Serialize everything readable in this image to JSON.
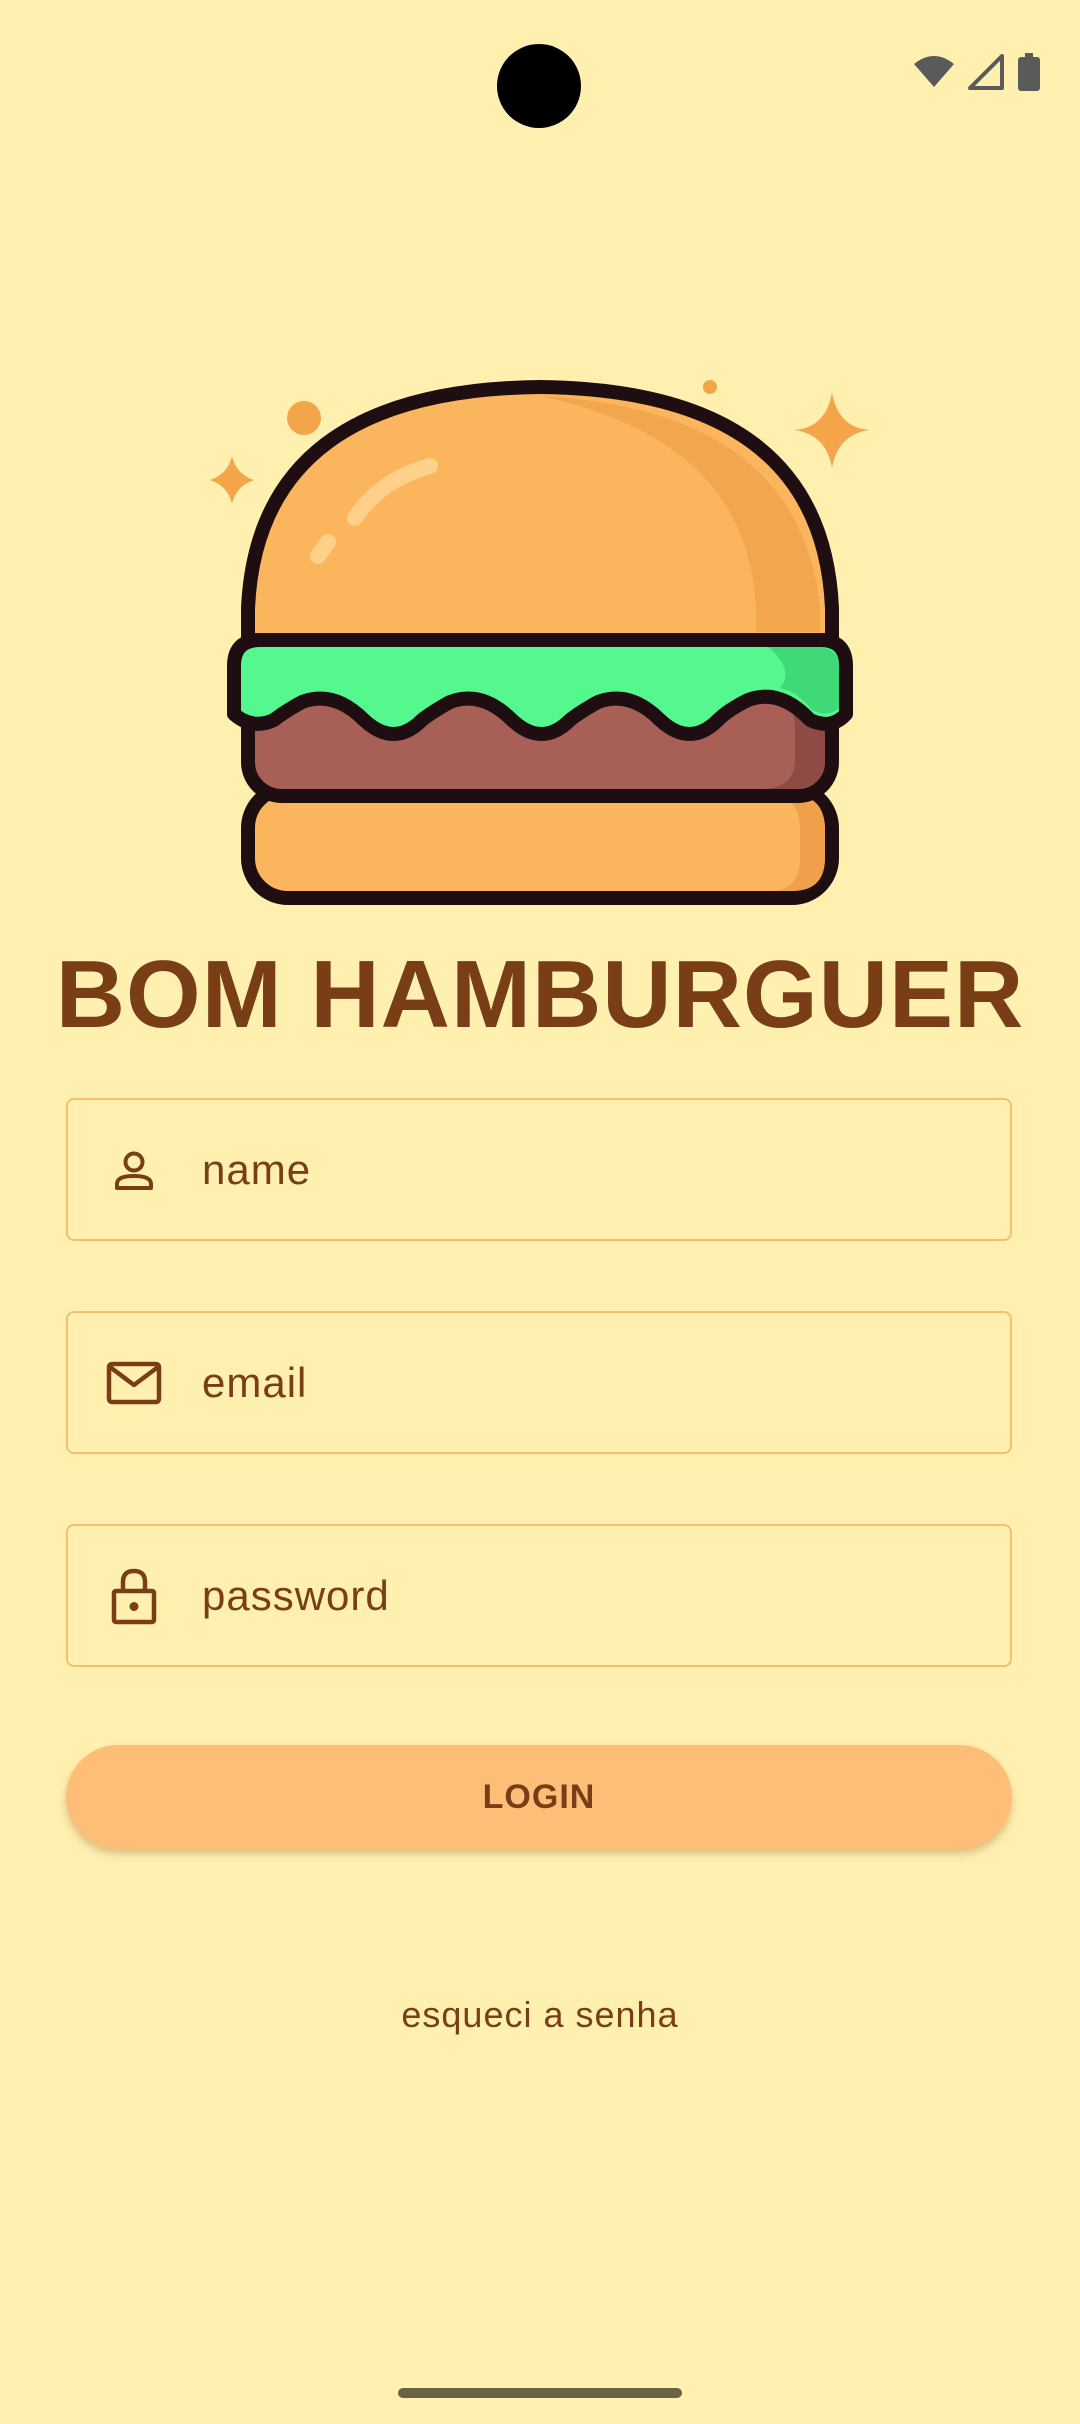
{
  "app": {
    "title": "BOM HAMBURGUER",
    "logo_icon": "hamburger-icon"
  },
  "status_bar": {
    "icons": [
      "wifi-icon",
      "cellular-signal-icon",
      "battery-icon"
    ]
  },
  "form": {
    "name": {
      "placeholder": "name",
      "icon": "person-icon"
    },
    "email": {
      "placeholder": "email",
      "icon": "mail-icon"
    },
    "password": {
      "placeholder": "password",
      "icon": "lock-icon"
    }
  },
  "actions": {
    "login_label": "LOGIN",
    "forgot_label": "esqueci a senha"
  },
  "colors": {
    "background": "#FFF0B0",
    "accent": "#FFBE78",
    "text": "#7A3E17",
    "field_border": "#F6BE6E"
  }
}
